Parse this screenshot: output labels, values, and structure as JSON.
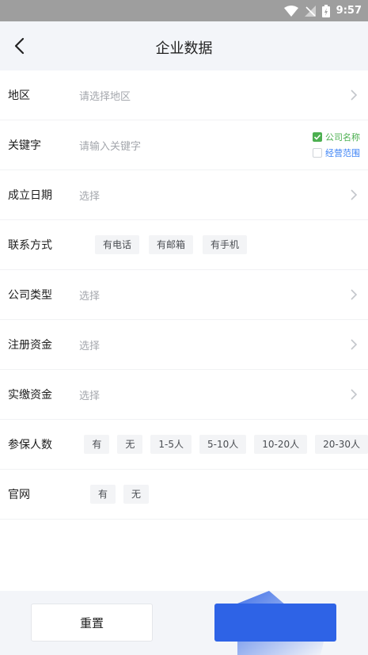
{
  "status_bar": {
    "time": "9:57"
  },
  "header": {
    "title": "企业数据"
  },
  "form": {
    "region": {
      "label": "地区",
      "placeholder": "请选择地区"
    },
    "keyword": {
      "label": "关键字",
      "placeholder": "请输入关键字",
      "options": [
        {
          "label": "公司名称",
          "checked": true
        },
        {
          "label": "经营范围",
          "checked": false
        }
      ]
    },
    "founded_date": {
      "label": "成立日期",
      "placeholder": "选择"
    },
    "contact": {
      "label": "联系方式",
      "chips": [
        "有电话",
        "有邮箱",
        "有手机"
      ]
    },
    "company_type": {
      "label": "公司类型",
      "placeholder": "选择"
    },
    "registered_capital": {
      "label": "注册资金",
      "placeholder": "选择"
    },
    "paid_capital": {
      "label": "实缴资金",
      "placeholder": "选择"
    },
    "insured_count": {
      "label": "参保人数",
      "chips": [
        "有",
        "无",
        "1-5人",
        "5-10人",
        "10-20人",
        "20-30人"
      ]
    },
    "website": {
      "label": "官网",
      "chips": [
        "有",
        "无"
      ]
    }
  },
  "footer": {
    "reset_label": "重置"
  },
  "colors": {
    "accent": "#2e63e6",
    "check": "#4caf50",
    "link": "#3b82f6"
  }
}
